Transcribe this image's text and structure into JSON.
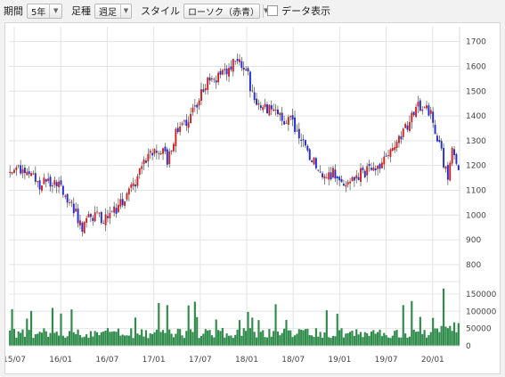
{
  "toolbar": {
    "period_label": "期間",
    "period_value": "5年",
    "interval_label": "足種",
    "interval_value": "週足",
    "style_label": "スタイル",
    "style_value": "ローソク（赤青）",
    "data_display_label": "データ表示",
    "data_display_checked": false
  },
  "chart_data": {
    "type": "candlestick",
    "price_axis": {
      "ticks": [
        800,
        900,
        1000,
        1100,
        1200,
        1300,
        1400,
        1500,
        1600,
        1700
      ],
      "range": [
        760,
        1760
      ]
    },
    "volume_axis": {
      "ticks": [
        0,
        50000,
        100000,
        150000
      ],
      "range": [
        0,
        160000
      ]
    },
    "x_ticks": [
      "15/07",
      "16/01",
      "16/07",
      "17/01",
      "17/07",
      "18/01",
      "18/07",
      "19/01",
      "19/07",
      "20/01"
    ],
    "grid": true,
    "up_color": "#d42020",
    "down_color": "#1f2bd8",
    "volume_color": "#2e8b4a",
    "close_path": [
      [
        0,
        1170
      ],
      [
        8,
        1185
      ],
      [
        14,
        1120
      ],
      [
        20,
        1140
      ],
      [
        24,
        1120
      ],
      [
        30,
        1030
      ],
      [
        34,
        950
      ],
      [
        38,
        1000
      ],
      [
        44,
        980
      ],
      [
        50,
        1020
      ],
      [
        54,
        1060
      ],
      [
        60,
        1150
      ],
      [
        64,
        1220
      ],
      [
        70,
        1270
      ],
      [
        74,
        1220
      ],
      [
        78,
        1330
      ],
      [
        82,
        1360
      ],
      [
        88,
        1450
      ],
      [
        92,
        1530
      ],
      [
        98,
        1560
      ],
      [
        104,
        1600
      ],
      [
        108,
        1630
      ],
      [
        112,
        1560
      ],
      [
        114,
        1480
      ],
      [
        120,
        1430
      ],
      [
        126,
        1400
      ],
      [
        132,
        1380
      ],
      [
        136,
        1310
      ],
      [
        140,
        1250
      ],
      [
        144,
        1200
      ],
      [
        148,
        1150
      ],
      [
        152,
        1170
      ],
      [
        156,
        1140
      ],
      [
        162,
        1150
      ],
      [
        168,
        1180
      ],
      [
        174,
        1200
      ],
      [
        178,
        1250
      ],
      [
        182,
        1280
      ],
      [
        186,
        1350
      ],
      [
        190,
        1420
      ],
      [
        194,
        1450
      ],
      [
        198,
        1400
      ],
      [
        202,
        1280
      ],
      [
        206,
        1150
      ],
      [
        208,
        1250
      ],
      [
        211,
        1200
      ]
    ]
  }
}
